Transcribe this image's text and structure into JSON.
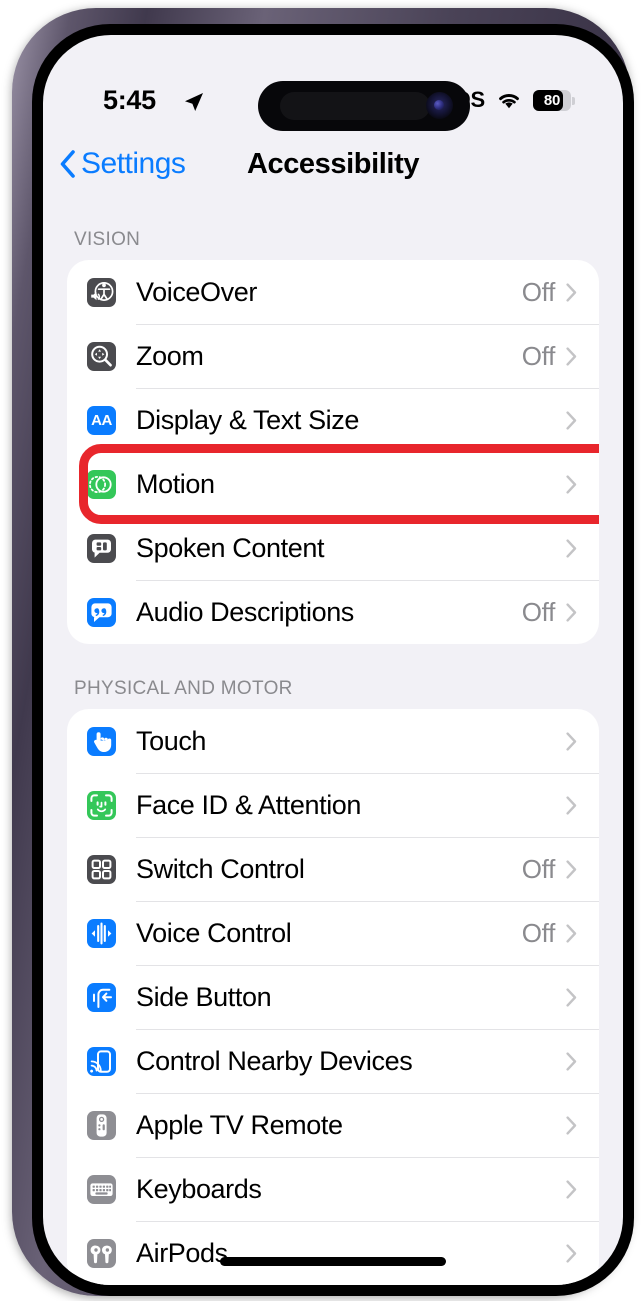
{
  "status_bar": {
    "time": "5:45",
    "location_icon": "location-arrow-icon",
    "sos_label": "SOS",
    "wifi_icon": "wifi-icon",
    "battery_percent": "80",
    "battery_level": 80
  },
  "nav": {
    "back_label": "Settings",
    "back_icon": "chevron-left-icon",
    "title": "Accessibility"
  },
  "sections": [
    {
      "header": "VISION",
      "rows": [
        {
          "label": "VoiceOver",
          "value": "Off",
          "icon": "voiceover-icon",
          "icon_style": "ic-dark",
          "glyph": "voiceover"
        },
        {
          "label": "Zoom",
          "value": "Off",
          "icon": "zoom-icon",
          "icon_style": "ic-dark",
          "glyph": "zoom"
        },
        {
          "label": "Display & Text Size",
          "value": "",
          "icon": "display-text-size-icon",
          "icon_style": "ic-blue",
          "glyph": "aa"
        },
        {
          "label": "Motion",
          "value": "",
          "icon": "motion-icon",
          "icon_style": "ic-green",
          "glyph": "motion",
          "highlighted": true
        },
        {
          "label": "Spoken Content",
          "value": "",
          "icon": "spoken-content-icon",
          "icon_style": "ic-dark",
          "glyph": "spoken"
        },
        {
          "label": "Audio Descriptions",
          "value": "Off",
          "icon": "audio-descriptions-icon",
          "icon_style": "ic-blue",
          "glyph": "quote"
        }
      ]
    },
    {
      "header": "PHYSICAL AND MOTOR",
      "rows": [
        {
          "label": "Touch",
          "value": "",
          "icon": "touch-icon",
          "icon_style": "ic-blue",
          "glyph": "hand"
        },
        {
          "label": "Face ID & Attention",
          "value": "",
          "icon": "face-id-icon",
          "icon_style": "ic-green",
          "glyph": "faceid"
        },
        {
          "label": "Switch Control",
          "value": "Off",
          "icon": "switch-control-icon",
          "icon_style": "ic-dark",
          "glyph": "grid"
        },
        {
          "label": "Voice Control",
          "value": "Off",
          "icon": "voice-control-icon",
          "icon_style": "ic-blue",
          "glyph": "waveform"
        },
        {
          "label": "Side Button",
          "value": "",
          "icon": "side-button-icon",
          "icon_style": "ic-blue",
          "glyph": "sidebutton"
        },
        {
          "label": "Control Nearby Devices",
          "value": "",
          "icon": "nearby-devices-icon",
          "icon_style": "ic-blue",
          "glyph": "nearby"
        },
        {
          "label": "Apple TV Remote",
          "value": "",
          "icon": "apple-tv-remote-icon",
          "icon_style": "ic-gray",
          "glyph": "remote"
        },
        {
          "label": "Keyboards",
          "value": "",
          "icon": "keyboards-icon",
          "icon_style": "ic-gray",
          "glyph": "keyboard"
        },
        {
          "label": "AirPods",
          "value": "",
          "icon": "airpods-icon",
          "icon_style": "ic-gray",
          "glyph": "airpods"
        }
      ]
    }
  ],
  "annotation": {
    "target_row": "Motion",
    "color": "#e8262c",
    "shape": "rounded-rectangle-outline"
  },
  "theme": {
    "accent_blue": "#0a7cff",
    "page_background": "#f2f1f6",
    "card_background": "#ffffff",
    "secondary_text": "#8a8a8e",
    "green": "#34c759"
  }
}
